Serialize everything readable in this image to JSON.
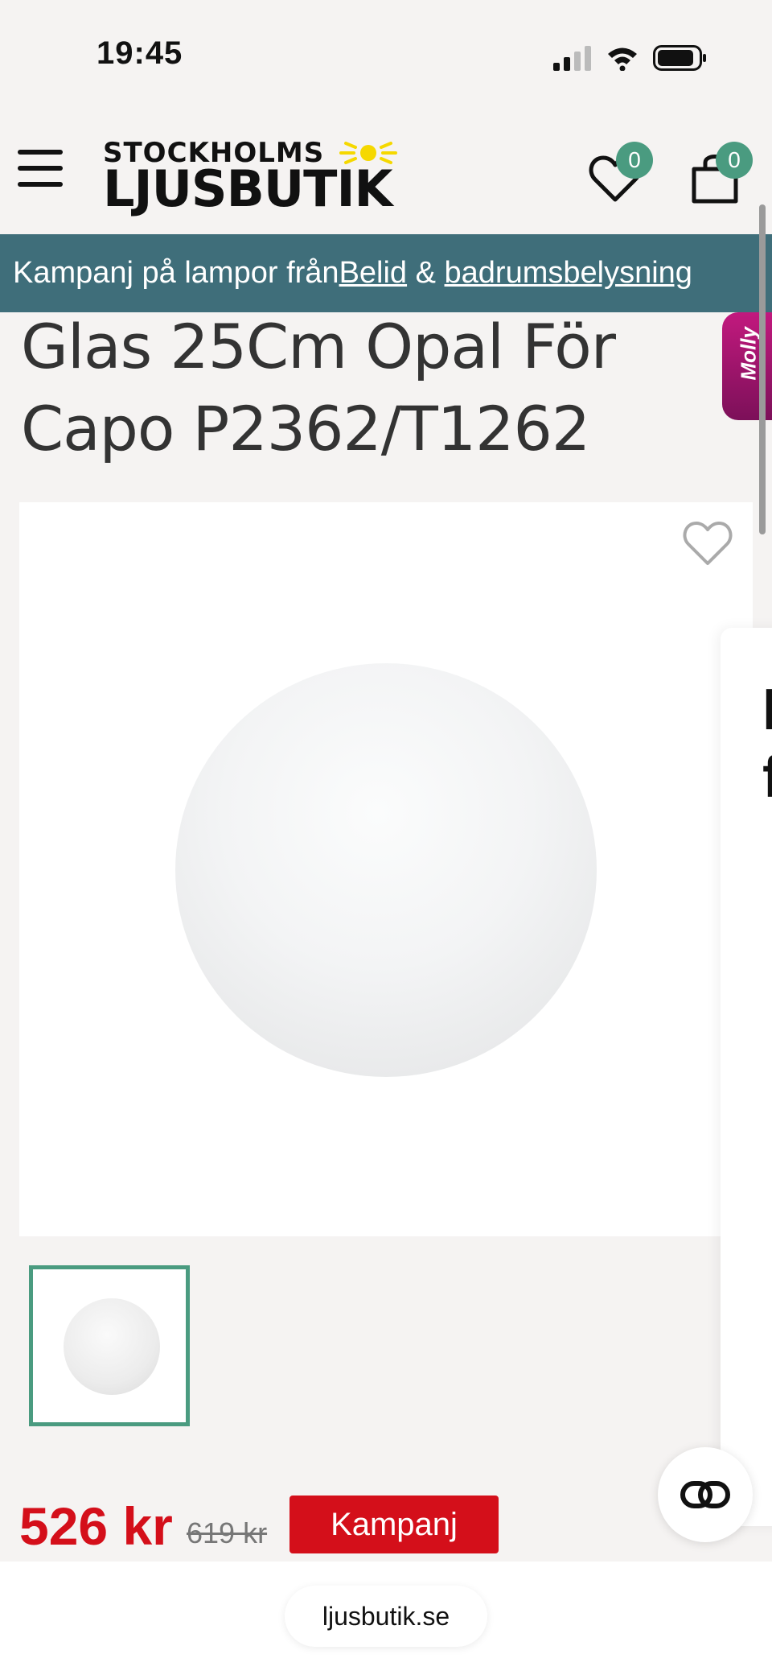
{
  "status_bar": {
    "time": "19:45",
    "icons": [
      "cellular-signal-icon",
      "wifi-icon",
      "battery-icon"
    ]
  },
  "header": {
    "logo_line1": "STOCKHOLMS",
    "logo_line2": "LJUSBUTIK",
    "wishlist_count": "0",
    "cart_count": "0"
  },
  "promo": {
    "prefix": "Kampanj på lampor från ",
    "link1": "Belid",
    "middle": " & ",
    "link2": "badrumsbelysning"
  },
  "product": {
    "title_line1": "Glas 25Cm Opal För",
    "title_line2": "Capo P2362/T1262",
    "price": "526 kr",
    "old_price": "619 kr",
    "badge": "Kampanj"
  },
  "molly": {
    "label": "Molly"
  },
  "side_card": {
    "text_line1": "I",
    "text_line2": "f"
  },
  "browser": {
    "url": "ljusbutik.se"
  },
  "colors": {
    "accent_green": "#4a9b80",
    "banner": "#3f6e7a",
    "price_red": "#d40f1a",
    "molly_magenta": "#c2197e"
  }
}
